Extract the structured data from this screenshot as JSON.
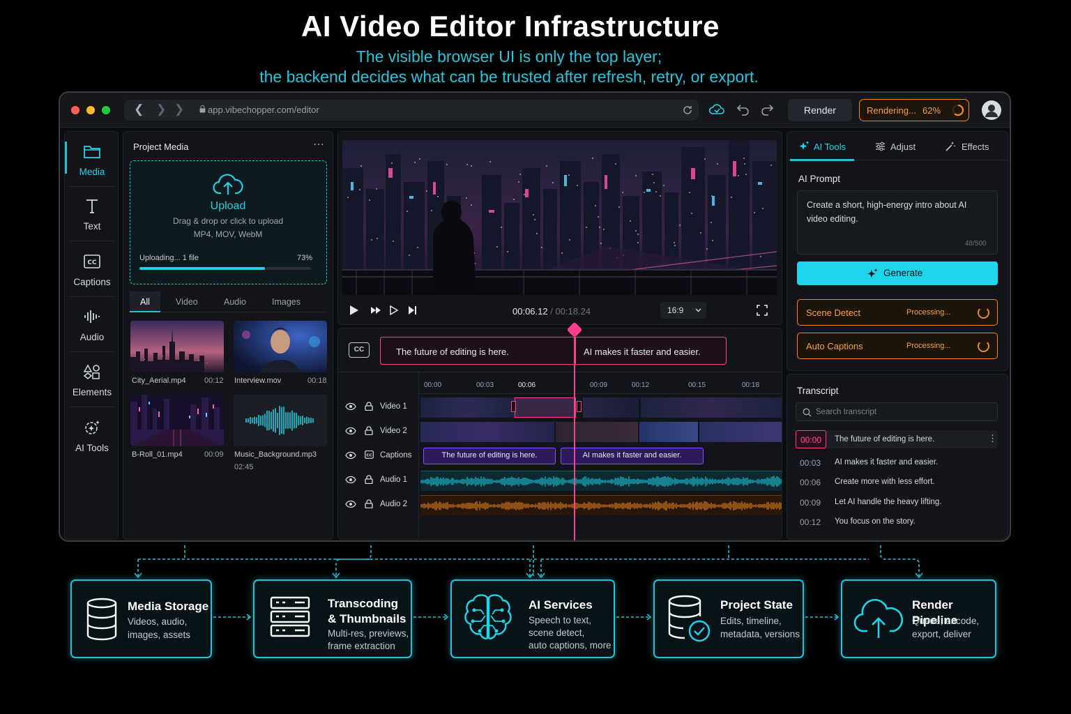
{
  "header": {
    "title": "AI Video Editor Infrastructure",
    "subtitle_line1": "The visible browser UI is only the top layer;",
    "subtitle_line2": "the backend decides what can be trusted after refresh, retry, or export."
  },
  "browser": {
    "url": "app.vibechopper.com/editor",
    "render_label": "Render",
    "rendering_label": "Rendering...",
    "rendering_progress": 62,
    "rendering_pct_text": "62%"
  },
  "rail": {
    "items": [
      {
        "label": "Media",
        "icon": "folder-icon"
      },
      {
        "label": "Text",
        "icon": "text-icon"
      },
      {
        "label": "Captions",
        "icon": "cc-icon"
      },
      {
        "label": "Audio",
        "icon": "audio-wave-icon"
      },
      {
        "label": "Elements",
        "icon": "shapes-icon"
      },
      {
        "label": "AI Tools",
        "icon": "sparkle-gear-icon"
      }
    ]
  },
  "media": {
    "title": "Project Media",
    "upload": {
      "label": "Upload",
      "desc": "Drag & drop or click to upload",
      "formats": "MP4, MOV, WebM",
      "status": "Uploading...  1 file",
      "progress": 73,
      "pct_text": "73%"
    },
    "tabs": [
      "All",
      "Video",
      "Audio",
      "Images"
    ],
    "items": [
      {
        "name": "City_Aerial.mp4",
        "duration": "00:12"
      },
      {
        "name": "Interview.mov",
        "duration": "00:18"
      },
      {
        "name": "B-Roll_01.mp4",
        "duration": "00:09"
      },
      {
        "name": "Music_Background.mp3",
        "duration": "02:45"
      }
    ]
  },
  "player": {
    "current": "00:06.12",
    "separator": " / ",
    "total": "00:18.24",
    "aspect": "16:9"
  },
  "timeline": {
    "caption_badge": "CC",
    "caption_1": "The future of editing is here.",
    "caption_2": "AI makes it faster and easier.",
    "ticks": [
      "00:00",
      "00:03",
      "00:06",
      "00:09",
      "00:12",
      "00:15",
      "00:18"
    ],
    "tracks": [
      "Video 1",
      "Video 2",
      "Captions",
      "Audio 1",
      "Audio 2"
    ]
  },
  "ai_panel": {
    "tabs": [
      "AI Tools",
      "Adjust",
      "Effects"
    ],
    "prompt_title": "AI Prompt",
    "prompt_text": "Create a short, high-energy intro about AI video editing.",
    "prompt_count": "48/500",
    "generate_label": "Generate",
    "jobs": [
      {
        "label": "Scene Detect",
        "status": "Processing..."
      },
      {
        "label": "Auto Captions",
        "status": "Processing..."
      }
    ]
  },
  "transcript": {
    "title": "Transcript",
    "search_placeholder": "Search transcript",
    "rows": [
      {
        "time": "00:00",
        "text": "The future of editing is here."
      },
      {
        "time": "00:03",
        "text": "AI makes it faster and easier."
      },
      {
        "time": "00:06",
        "text": "Create more with less effort."
      },
      {
        "time": "00:09",
        "text": "Let AI handle the heavy lifting."
      },
      {
        "time": "00:12",
        "text": "You focus on the story."
      }
    ]
  },
  "backend": {
    "nodes": [
      {
        "title": "Media Storage",
        "title2": "",
        "desc": [
          "Videos, audio,",
          "images, assets"
        ],
        "icon": "database-icon"
      },
      {
        "title": "Transcoding",
        "title2": "& Thumbnails",
        "desc": [
          "Multi-res, previews,",
          "frame extraction"
        ],
        "icon": "server-icon"
      },
      {
        "title": "AI Services",
        "title2": "",
        "desc": [
          "Speech to text,",
          "scene detect,",
          "auto captions, more"
        ],
        "icon": "brain-icon"
      },
      {
        "title": "Project State",
        "title2": "",
        "desc": [
          "Edits, timeline,",
          "metadata, versions"
        ],
        "icon": "database-check-icon"
      },
      {
        "title": "Render Pipeline",
        "title2": "",
        "desc": [
          "Queue, encode,",
          "export, deliver"
        ],
        "icon": "cloud-upload-icon"
      }
    ]
  },
  "colors": {
    "accent": "#1fd5ec",
    "pink": "#ff3f8e",
    "orange": "#f28a1f",
    "purple": "#8a4fff"
  }
}
